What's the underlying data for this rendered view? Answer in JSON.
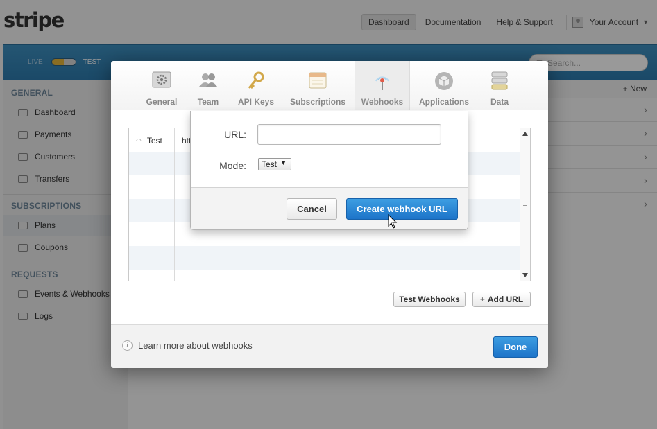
{
  "app": {
    "logo": "stripe"
  },
  "topnav": {
    "dashboard": "Dashboard",
    "documentation": "Documentation",
    "help": "Help & Support",
    "account": "Your Account"
  },
  "modebar": {
    "live": "LIVE",
    "test": "TEST",
    "search_placeholder": "Search..."
  },
  "sidebar": {
    "sections": [
      {
        "title": "GENERAL",
        "items": [
          "Dashboard",
          "Payments",
          "Customers",
          "Transfers"
        ]
      },
      {
        "title": "SUBSCRIPTIONS",
        "items": [
          "Plans",
          "Coupons"
        ]
      },
      {
        "title": "REQUESTS",
        "items": [
          "Events & Webhooks",
          "Logs"
        ]
      }
    ],
    "active_item": "Plans"
  },
  "content": {
    "new_label": "New"
  },
  "modal": {
    "tabs": [
      {
        "label": "General",
        "icon": "gear-icon"
      },
      {
        "label": "Team",
        "icon": "team-icon"
      },
      {
        "label": "API Keys",
        "icon": "key-icon"
      },
      {
        "label": "Subscriptions",
        "icon": "subscriptions-icon"
      },
      {
        "label": "Webhooks",
        "icon": "webhook-icon",
        "active": true
      },
      {
        "label": "Applications",
        "icon": "applications-icon"
      },
      {
        "label": "Data",
        "icon": "data-icon"
      }
    ],
    "webhook_row": {
      "mode": "Test",
      "url_prefix": "htt"
    },
    "buttons": {
      "test_webhooks": "Test Webhooks",
      "add_url": "Add URL",
      "done": "Done"
    },
    "learn_more": "Learn more about webhooks"
  },
  "popover": {
    "url_label": "URL:",
    "url_value": "",
    "mode_label": "Mode:",
    "mode_value": "Test",
    "cancel": "Cancel",
    "create": "Create webhook URL"
  },
  "colors": {
    "primary": "#1d74c9",
    "bluebar": "#3384b7",
    "toggle_live": "#e7b63a"
  }
}
